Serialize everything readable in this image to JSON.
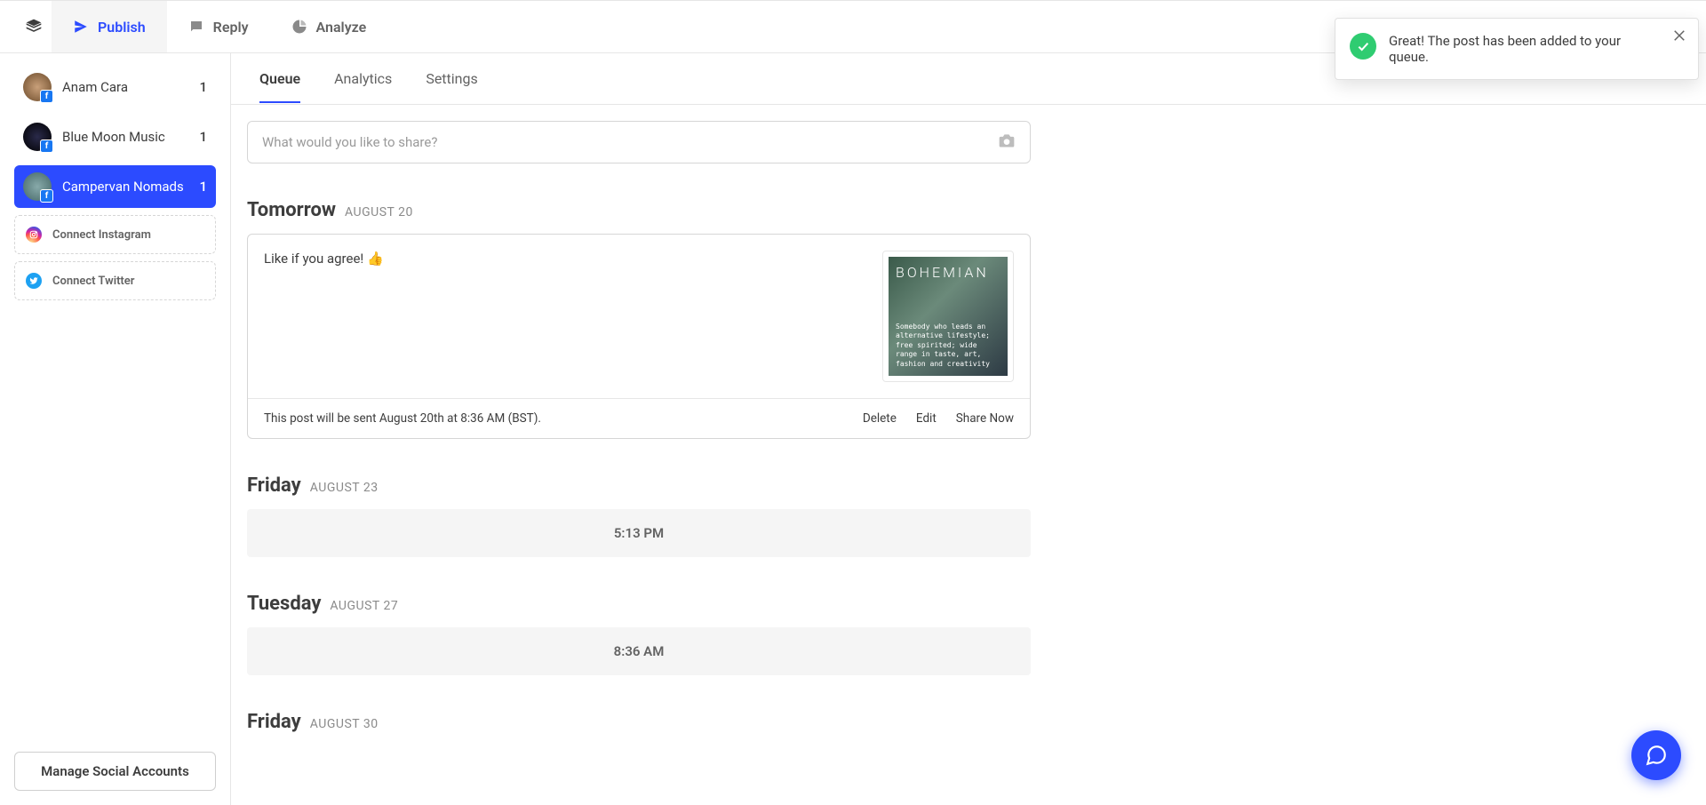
{
  "nav": {
    "publish": "Publish",
    "reply": "Reply",
    "analyze": "Analyze"
  },
  "sidebar": {
    "accounts": [
      {
        "name": "Anam Cara",
        "count": "1",
        "network": "facebook"
      },
      {
        "name": "Blue Moon Music",
        "count": "1",
        "network": "facebook"
      },
      {
        "name": "Campervan Nomads",
        "count": "1",
        "network": "facebook"
      }
    ],
    "connect_instagram": "Connect Instagram",
    "connect_twitter": "Connect Twitter",
    "manage": "Manage Social Accounts"
  },
  "tabs": {
    "queue": "Queue",
    "analytics": "Analytics",
    "settings": "Settings"
  },
  "composer": {
    "placeholder": "What would you like to share?"
  },
  "days": [
    {
      "label": "Tomorrow",
      "date": "AUGUST 20",
      "post": {
        "text": "Like if you agree! 👍",
        "schedule_note": "This post will be sent August 20th at 8:36 AM (BST).",
        "thumb_title": "BOHEMIAN",
        "thumb_caption": "Somebody who leads an alternative lifestyle; free spirited; wide range in taste, art, fashion and creativity",
        "actions": {
          "delete": "Delete",
          "edit": "Edit",
          "share_now": "Share Now"
        }
      }
    },
    {
      "label": "Friday",
      "date": "AUGUST 23",
      "slot_time": "5:13 PM"
    },
    {
      "label": "Tuesday",
      "date": "AUGUST 27",
      "slot_time": "8:36 AM"
    },
    {
      "label": "Friday",
      "date": "AUGUST 30"
    }
  ],
  "toast": {
    "message": "Great! The post has been added to your queue."
  }
}
